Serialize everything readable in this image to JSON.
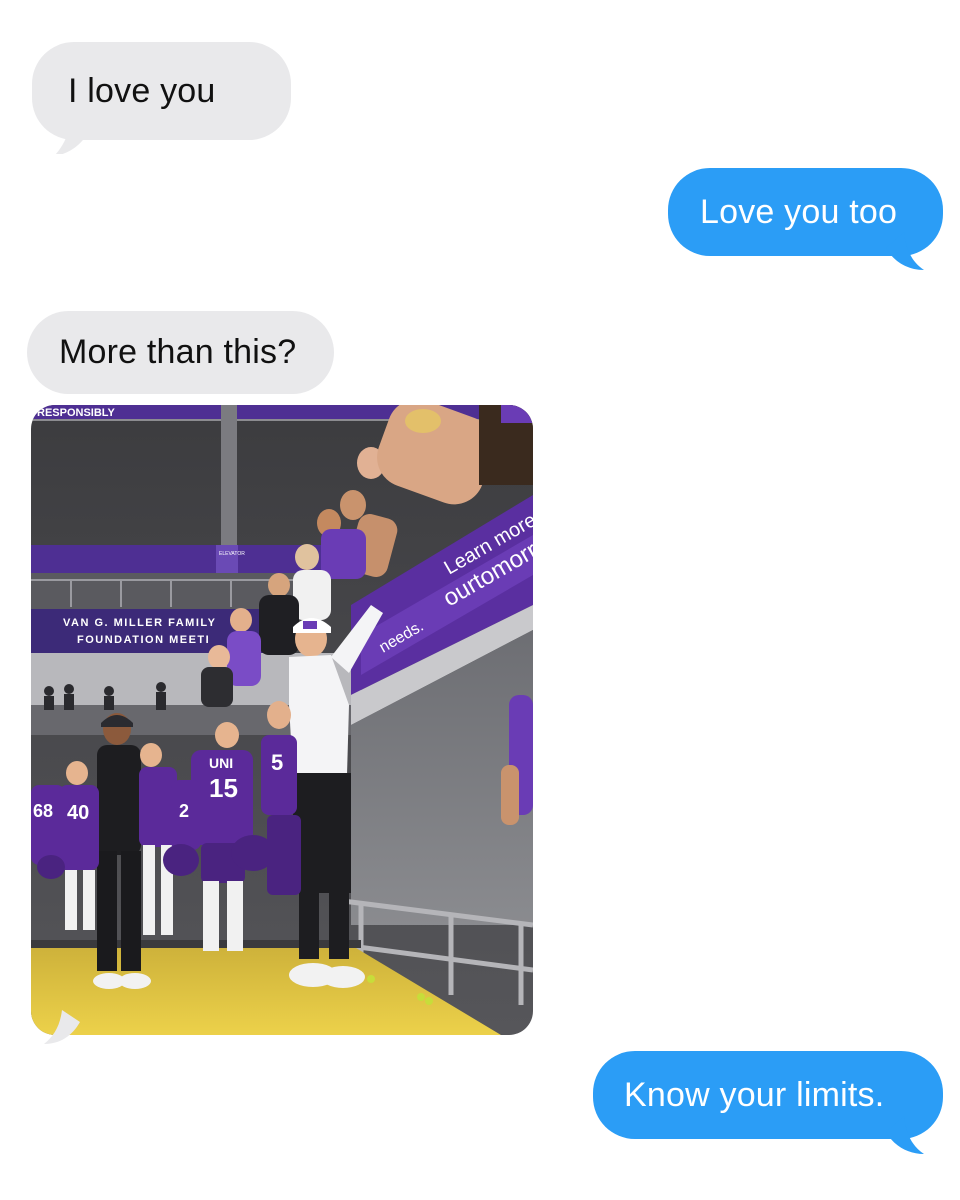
{
  "conversation": {
    "messages": [
      {
        "direction": "incoming",
        "type": "text",
        "text": "I love you"
      },
      {
        "direction": "outgoing",
        "type": "text",
        "text": "Love you too"
      },
      {
        "direction": "incoming",
        "type": "text",
        "text": "More than this?"
      },
      {
        "direction": "incoming",
        "type": "image",
        "image": {
          "banner_text": "RESPONSIBLY",
          "sign_line1": "VAN G. MILLER FAMILY",
          "sign_line2": "FOUNDATION MEETI",
          "wall_line1": "Learn more and give",
          "wall_line2": "ourtomorrow",
          "wall_fragment": "needs.",
          "elevator_label": "ELEVATOR",
          "jersey_text": "UNI",
          "jersey_numbers": [
            "68",
            "40",
            "15",
            "2",
            "5"
          ],
          "floor_color": "#e3c336",
          "team_color": "#5b2a9a"
        }
      },
      {
        "direction": "outgoing",
        "type": "text",
        "text": "Know your limits."
      }
    ]
  },
  "colors": {
    "incoming_bubble": "#e9e9eb",
    "outgoing_bubble": "#2b9df6",
    "background": "#ffffff"
  }
}
